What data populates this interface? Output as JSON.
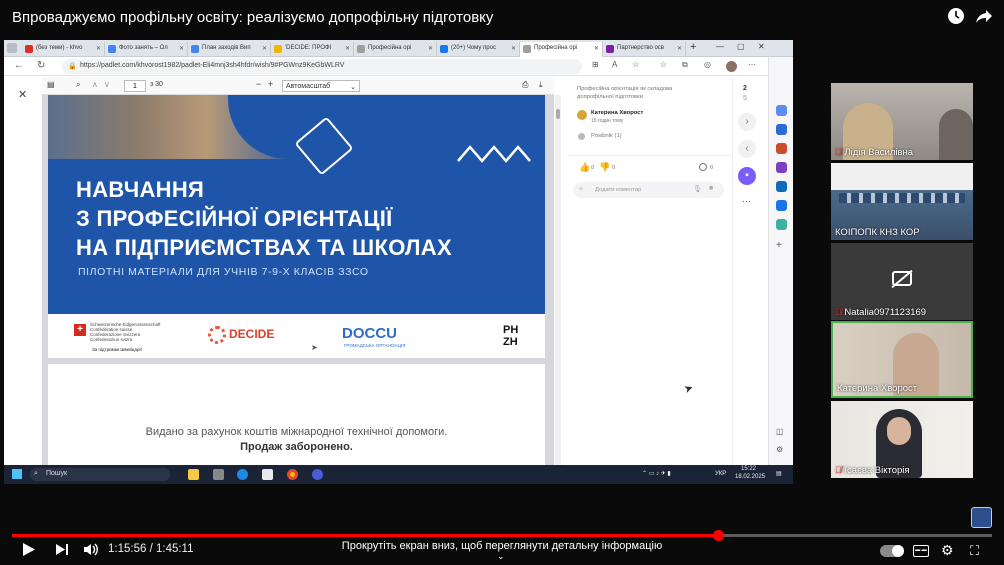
{
  "video": {
    "title": "Впроваджуємо профільну освіту: реалізуємо допрофільну підготовку",
    "time_current": "1:15:56",
    "time_separator": "/",
    "time_total": "1:45:11",
    "progress": 0.72,
    "scroll_hint": "Прокрутіть екран вниз, щоб переглянути детальну інформацію"
  },
  "browser": {
    "tabs": [
      {
        "label": "(без теми) - khvo",
        "color": "#d93025"
      },
      {
        "label": "Фото занять – Ол",
        "color": "#4285f4"
      },
      {
        "label": "План заходів Вип",
        "color": "#4285f4"
      },
      {
        "label": "'DECIDE: ПРОФІ",
        "color": "#f4b400"
      },
      {
        "label": "Професійна орі",
        "color": "#9e9e9e"
      },
      {
        "label": "(20+) Чому прос",
        "color": "#1877f2"
      },
      {
        "label": "Професійна орі",
        "color": "#9e9e9e"
      },
      {
        "label": "Партнерство осв",
        "color": "#7b1fa2"
      }
    ],
    "new_tab": "+",
    "url": "https://padlet.com/khvorost1982/padlet-Eli4mnj3sh4hfdr/wish/9#PGWnz9KeGbWLRV"
  },
  "pdf": {
    "page_current": "1",
    "page_total": "з 30",
    "zoom": "Автомасштаб",
    "cover_lines": [
      "НАВЧАННЯ",
      "З ПРОФЕСІЙНОЇ ОРІЄНТАЦІЇ",
      "НА ПІДПРИЄМСТВАХ ТА ШКОЛАХ"
    ],
    "cover_subtitle": "ПІЛОТНІ МАТЕРІАЛИ ДЛЯ УЧНІВ 7-9-Х КЛАСІВ ЗЗСО",
    "swiss_lines": [
      "Schweizerische Eidgenossenschaft",
      "Confédération suisse",
      "Confederazione Svizzera",
      "Confederaziun svizra"
    ],
    "swiss_support": "За підтримки Швейцарії",
    "logo_decide": "DECIDE",
    "logo_doccu": "DOCCU",
    "logo_doccu_sub": "ГРОМАДСЬКА ОРГАНІЗАЦІЯ",
    "logo_phzh": "PH ZH",
    "funded_line1": "Видано за рахунок коштів міжнародної технічної допомоги.",
    "funded_line2": "Продаж заборонено."
  },
  "padlet": {
    "post_title_1": "Професійна орієнтація як складова",
    "post_title_2": "допрофільної підготовки",
    "author": "Катерина Хворост",
    "ago": "15 годин тому",
    "attachment": "Posibnik (1)",
    "likes": "0",
    "dislikes": "0",
    "comments": "0",
    "comment_placeholder": "Додати коментар",
    "counter_top": "2",
    "counter_bottom": "5"
  },
  "taskbar": {
    "search": "Пошук",
    "lang": "УКР",
    "clock": "15:22",
    "date": "18.02.2025"
  },
  "participants": [
    {
      "name": "Лідія Василівна",
      "muted": true
    },
    {
      "name": "КОІПОПК КНЗ КОР",
      "muted": false
    },
    {
      "name": "Natalia0971123169",
      "muted": true
    },
    {
      "name": "Катерина Хворост",
      "muted": false
    },
    {
      "name": "Ісаєва Вікторія",
      "muted": true
    }
  ],
  "colors": {
    "accent": "#ff0000",
    "cover_blue": "#1f55a8",
    "active_speaker": "#4caf50"
  }
}
